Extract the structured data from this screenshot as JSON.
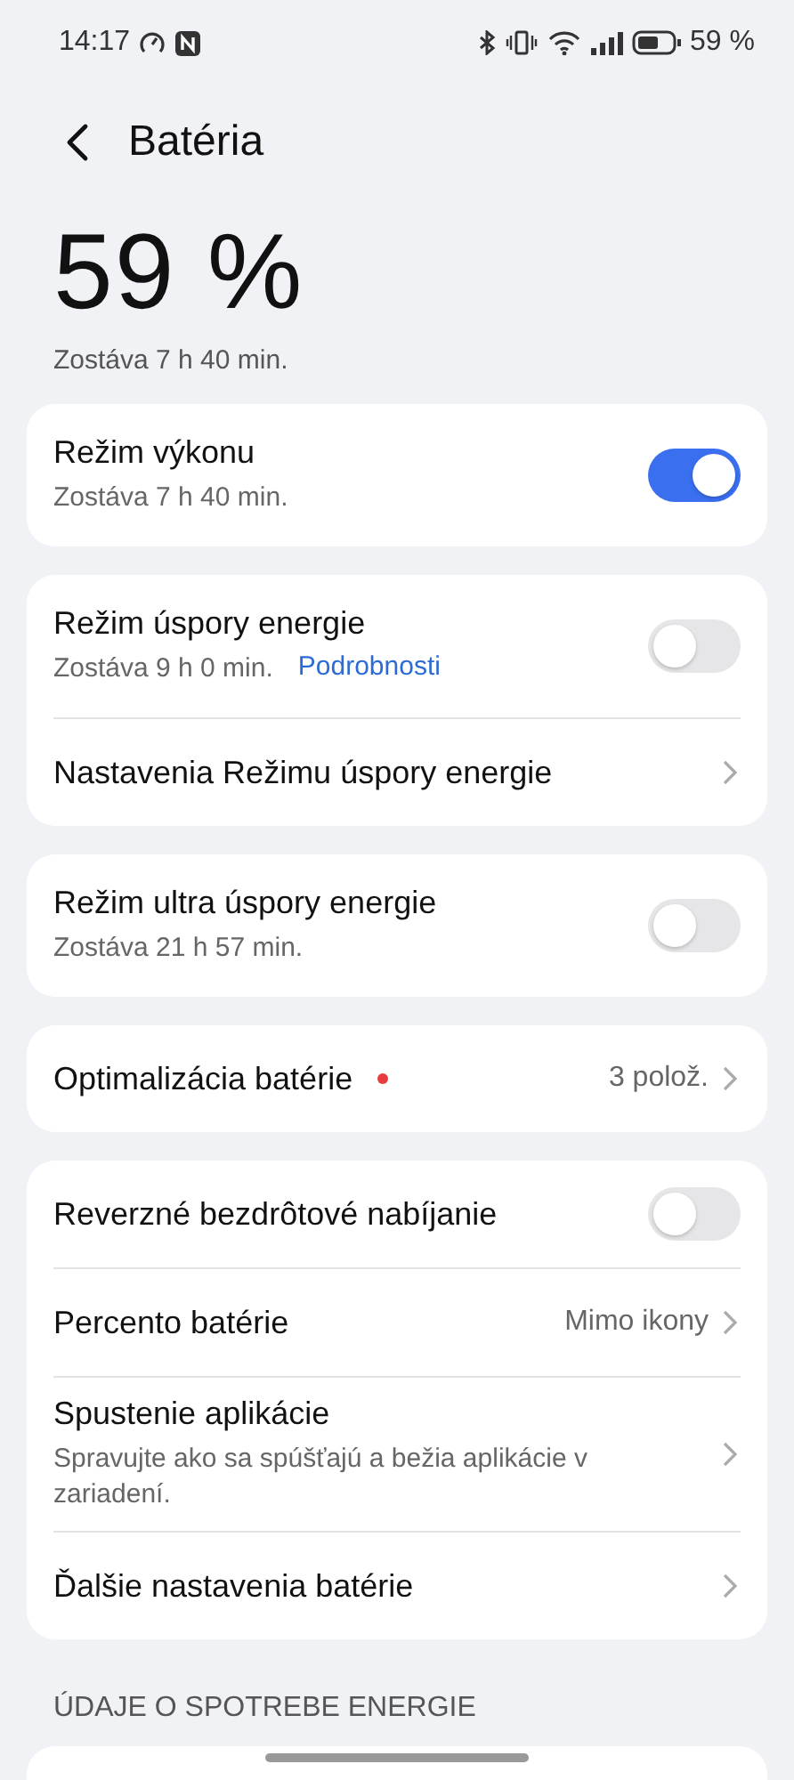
{
  "status_bar": {
    "time": "14:17",
    "battery": "59 %"
  },
  "header": {
    "title": "Batéria"
  },
  "battery": {
    "percent": "59 %",
    "remaining": "Zostáva 7 h 40 min."
  },
  "groups": [
    {
      "rows": [
        {
          "kind": "toggle",
          "title": "Režim výkonu",
          "subtitle": "Zostáva 7 h 40 min.",
          "on": true
        }
      ]
    },
    {
      "rows": [
        {
          "kind": "toggle",
          "title": "Režim úspory energie",
          "subtitle": "Zostáva 9 h 0 min.",
          "link": "Podrobnosti",
          "on": false
        },
        {
          "kind": "link",
          "title": "Nastavenia Režimu úspory energie"
        }
      ]
    },
    {
      "rows": [
        {
          "kind": "toggle",
          "title": "Režim ultra úspory energie",
          "subtitle": "Zostáva 21 h 57 min.",
          "on": false
        }
      ]
    },
    {
      "rows": [
        {
          "kind": "link",
          "title": "Optimalizácia batérie",
          "dot": true,
          "value": "3 polož."
        }
      ]
    },
    {
      "rows": [
        {
          "kind": "toggle",
          "title": "Reverzné bezdrôtové nabíjanie",
          "on": false
        },
        {
          "kind": "link",
          "title": "Percento batérie",
          "value": "Mimo ikony"
        },
        {
          "kind": "link",
          "title": "Spustenie aplikácie",
          "subtitle": "Spravujte ako sa spúšťajú a bežia aplikácie v zariadení."
        },
        {
          "kind": "link",
          "title": "Ďalšie nastavenia batérie"
        }
      ]
    }
  ],
  "section_title": "ÚDAJE O SPOTREBE ENERGIE"
}
